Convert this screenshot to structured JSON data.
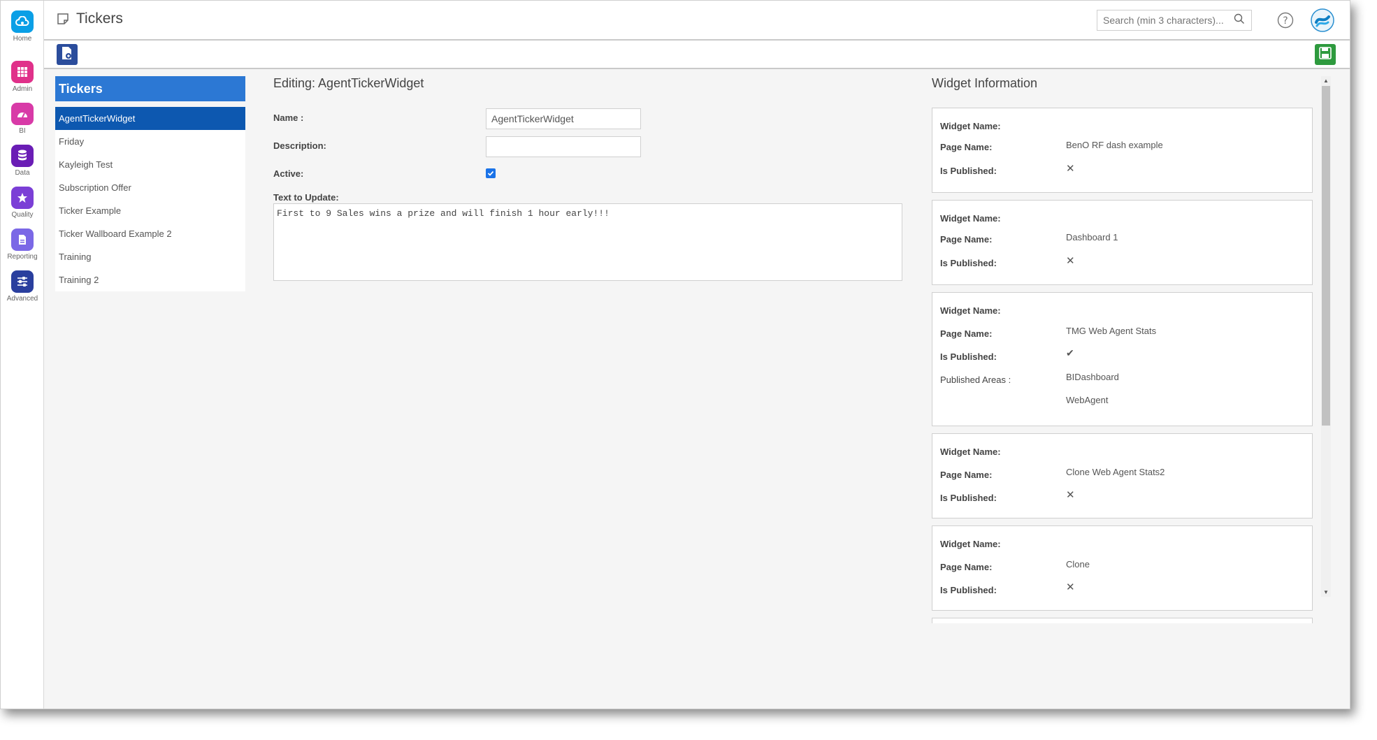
{
  "rail": [
    {
      "label": "Home",
      "icon": "cloud-icon",
      "color": "#0a9fe6"
    },
    {
      "label": "Admin",
      "icon": "grid-icon",
      "color": "#e0318a"
    },
    {
      "label": "BI",
      "icon": "gauge-icon",
      "color": "#d83aa7"
    },
    {
      "label": "Data",
      "icon": "database-icon",
      "color": "#6a1db5"
    },
    {
      "label": "Quality",
      "icon": "star-icon",
      "color": "#7b3fd6"
    },
    {
      "label": "Reporting",
      "icon": "document-icon",
      "color": "#7b68e6"
    },
    {
      "label": "Advanced",
      "icon": "sliders-icon",
      "color": "#2a3f9e"
    }
  ],
  "header": {
    "title": "Tickers",
    "search_placeholder": "Search (min 3 characters)..."
  },
  "tickers": {
    "title": "Tickers",
    "items": [
      "AgentTickerWidget",
      "Friday",
      "Kayleigh Test",
      "Subscription Offer",
      "Ticker Example",
      "Ticker Wallboard Example 2",
      "Training",
      "Training 2"
    ],
    "selected": "AgentTickerWidget"
  },
  "edit": {
    "title": "Editing: AgentTickerWidget",
    "name_label": "Name :",
    "name_value": "AgentTickerWidget",
    "description_label": "Description:",
    "description_value": "",
    "active_label": "Active:",
    "active": true,
    "text_label": "Text to Update:",
    "text_value": "First to 9 Sales wins a prize and will finish 1 hour early!!!"
  },
  "widget_info": {
    "title": "Widget Information",
    "widget_name_label": "Widget Name:",
    "page_name_label": "Page Name:",
    "is_published_label": "Is Published:",
    "published_areas_label": "Published Areas :",
    "cards": [
      {
        "widget_name": "",
        "page_name": "BenO RF dash example",
        "published": false
      },
      {
        "widget_name": "",
        "page_name": "Dashboard 1",
        "published": false
      },
      {
        "widget_name": "",
        "page_name": "TMG Web Agent Stats",
        "published": true,
        "areas": [
          "BIDashboard",
          "WebAgent"
        ]
      },
      {
        "widget_name": "",
        "page_name": "Clone Web Agent Stats2",
        "published": false
      },
      {
        "widget_name": "",
        "page_name": "Clone",
        "published": false
      }
    ]
  },
  "colors": {
    "accent": "#2c78d4",
    "selected": "#0d58b0",
    "unpublished": "#e53935",
    "published": "#6abf4b",
    "save": "#2e9a3e"
  }
}
